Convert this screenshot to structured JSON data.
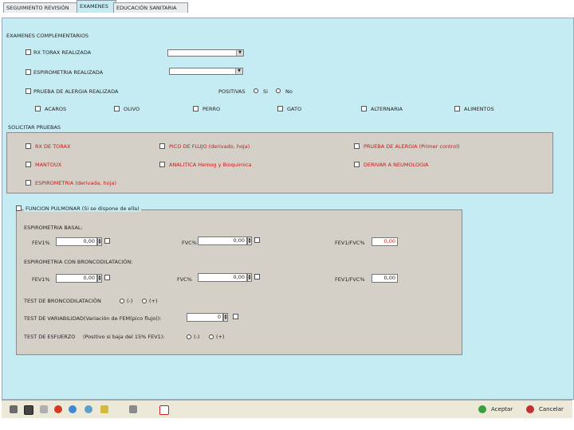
{
  "tabs": [
    "SEGUIMIENTO REVISIÓN",
    "EXAMENES",
    "EDUCACIÓN SANITARIA"
  ],
  "sections": {
    "complementarios": "EXAMENES COMPLEMENTARIOS",
    "solicitar": "SOLICITAR PRUEBAS",
    "funcion": "FUNCION PULMONAR (Si se dispone de ella)"
  },
  "complementarios": {
    "rx_label": "RX TORAX REALIZADA",
    "espiro_label": "ESPIROMETRIA REALIZADA",
    "alergia_label": "PRUEBA DE ALERGIA REALIZADA",
    "positivas_label": "POSITIVAS",
    "si_label": "Si",
    "no_label": "No",
    "alergenos": [
      "ACAROS",
      "OLIVO",
      "PERRO",
      "GATO",
      "ALTERNARIA",
      "ALIMENTOS"
    ]
  },
  "pruebas": {
    "rx": "RX DE TORAX",
    "pico_flujo": "PICO DE FLUJO (derivado, hoja)",
    "alergia": "PRUEBA DE ALERGIA (Primer control)",
    "mantoux": "MANTOUX",
    "analitica": "ANALITICA Hemog y Bioquimica",
    "neumologia": "DERIVAR A NEUMOLOGIA",
    "espirometria": "ESPIROMETRIA (derivada, hoja)"
  },
  "funcion": {
    "basal_title": "ESPIROMETRIA BASAL:",
    "bronco_title": "ESPIROMETRIA CON BRONCODILATACIÓN:",
    "fev1_label": "FEV1%",
    "fvc_label": "FVC%",
    "ratio_label": "FEV1/FVC%",
    "basal_fev1": "0,00",
    "basal_fvc": "0,00",
    "basal_ratio": "0,00",
    "bronco_fev1": "0,00",
    "bronco_fvc": "0,00",
    "bronco_ratio": "0,00",
    "test_bronco": "TEST DE BRONCODILATACIÓN",
    "test_variabilidad": "TEST DE VARIABILIDAD(Variación de FEM(pico flujo)):",
    "variabilidad_value": "0",
    "test_esfuerzo": "TEST DE ESFUERZO",
    "esfuerzo_note": "(Positivo si baja del 15% FEV1):",
    "minus": "(-)",
    "plus": "(+)"
  },
  "taskbar": {
    "aceptar": "Aceptar",
    "cancelar": "Cancelar",
    "icons": [
      "save-icon",
      "print-icon",
      "pen-icon",
      "heart-icon",
      "globe-icon",
      "search-icon",
      "key-icon",
      "tools-icon",
      "flag-icon"
    ]
  }
}
